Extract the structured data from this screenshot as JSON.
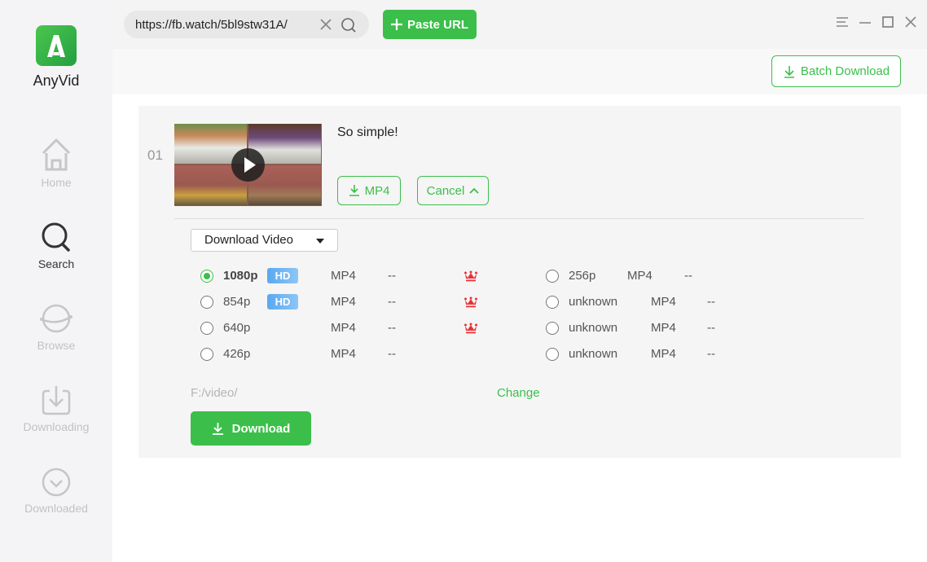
{
  "app": {
    "name": "AnyVid"
  },
  "sidebar": {
    "items": [
      {
        "label": "Home",
        "icon": "home-icon",
        "active": false
      },
      {
        "label": "Search",
        "icon": "search-icon",
        "active": true
      },
      {
        "label": "Browse",
        "icon": "planet-icon",
        "active": false
      },
      {
        "label": "Downloading",
        "icon": "download-tray-icon",
        "active": false
      },
      {
        "label": "Downloaded",
        "icon": "check-circle-icon",
        "active": false
      }
    ]
  },
  "topbar": {
    "url_value": "https://fb.watch/5bl9stw31A/",
    "paste_label": "Paste URL",
    "window_controls": [
      "menu-icon",
      "minimize-icon",
      "maximize-icon",
      "close-icon"
    ]
  },
  "batch": {
    "label": "Batch Download"
  },
  "video": {
    "index": "01",
    "title": "So simple!",
    "mp4_label": "MP4",
    "cancel_label": "Cancel",
    "type_select": "Download Video",
    "options_left": [
      {
        "resolution": "1080p",
        "hd": "HD",
        "format": "MP4",
        "size": "--",
        "premium": true,
        "selected": true
      },
      {
        "resolution": "854p",
        "hd": "HD",
        "format": "MP4",
        "size": "--",
        "premium": true,
        "selected": false
      },
      {
        "resolution": "640p",
        "hd": "",
        "format": "MP4",
        "size": "--",
        "premium": true,
        "selected": false
      },
      {
        "resolution": "426p",
        "hd": "",
        "format": "MP4",
        "size": "--",
        "premium": false,
        "selected": false
      }
    ],
    "options_right": [
      {
        "resolution": "256p",
        "format": "MP4",
        "size": "--",
        "selected": false
      },
      {
        "resolution": "unknown",
        "format": "MP4",
        "size": "--",
        "selected": false
      },
      {
        "resolution": "unknown",
        "format": "MP4",
        "size": "--",
        "selected": false
      },
      {
        "resolution": "unknown",
        "format": "MP4",
        "size": "--",
        "selected": false
      }
    ],
    "save_path": "F:/video/",
    "change_label": "Change",
    "download_label": "Download"
  },
  "colors": {
    "accent": "#3bbf4a",
    "hd_badge": "#5aa8f0",
    "premium": "#e8333a"
  }
}
